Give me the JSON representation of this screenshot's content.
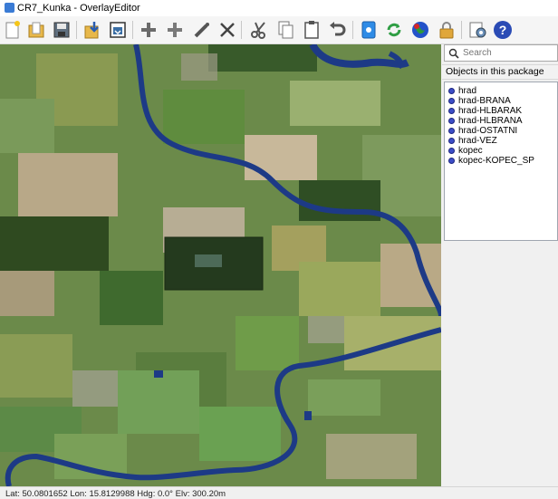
{
  "window": {
    "title": "CR7_Kunka - OverlayEditor"
  },
  "toolbar": {
    "buttons": [
      {
        "name": "new-icon"
      },
      {
        "name": "open-icon"
      },
      {
        "name": "save-icon"
      },
      {
        "name": "import-icon"
      },
      {
        "name": "export-icon"
      },
      {
        "name": "add-icon"
      },
      {
        "name": "add-object-icon"
      },
      {
        "name": "draw-icon"
      },
      {
        "name": "cut-lines-icon"
      },
      {
        "name": "scissors-icon"
      },
      {
        "name": "copy-icon"
      },
      {
        "name": "paste-icon"
      },
      {
        "name": "undo-icon"
      },
      {
        "name": "import-file-icon"
      },
      {
        "name": "refresh-icon"
      },
      {
        "name": "globe-icon"
      },
      {
        "name": "lock-icon"
      },
      {
        "name": "preferences-icon"
      },
      {
        "name": "help-icon"
      }
    ]
  },
  "search": {
    "placeholder": "Search"
  },
  "objects_panel": {
    "header": "Objects in this package",
    "items": [
      {
        "label": "hrad"
      },
      {
        "label": "hrad-BRANA"
      },
      {
        "label": "hrad-HLBARAK"
      },
      {
        "label": "hrad-HLBRANA"
      },
      {
        "label": "hrad-OSTATNI"
      },
      {
        "label": "hrad-VEZ"
      },
      {
        "label": "kopec"
      },
      {
        "label": "kopec-KOPEC_SP"
      }
    ],
    "icon_color": "#3d4ec7"
  },
  "status": {
    "text": "Lat: 50.0801652  Lon: 15.8129988  Hdg: 0.0°  Elv: 300.20m"
  }
}
